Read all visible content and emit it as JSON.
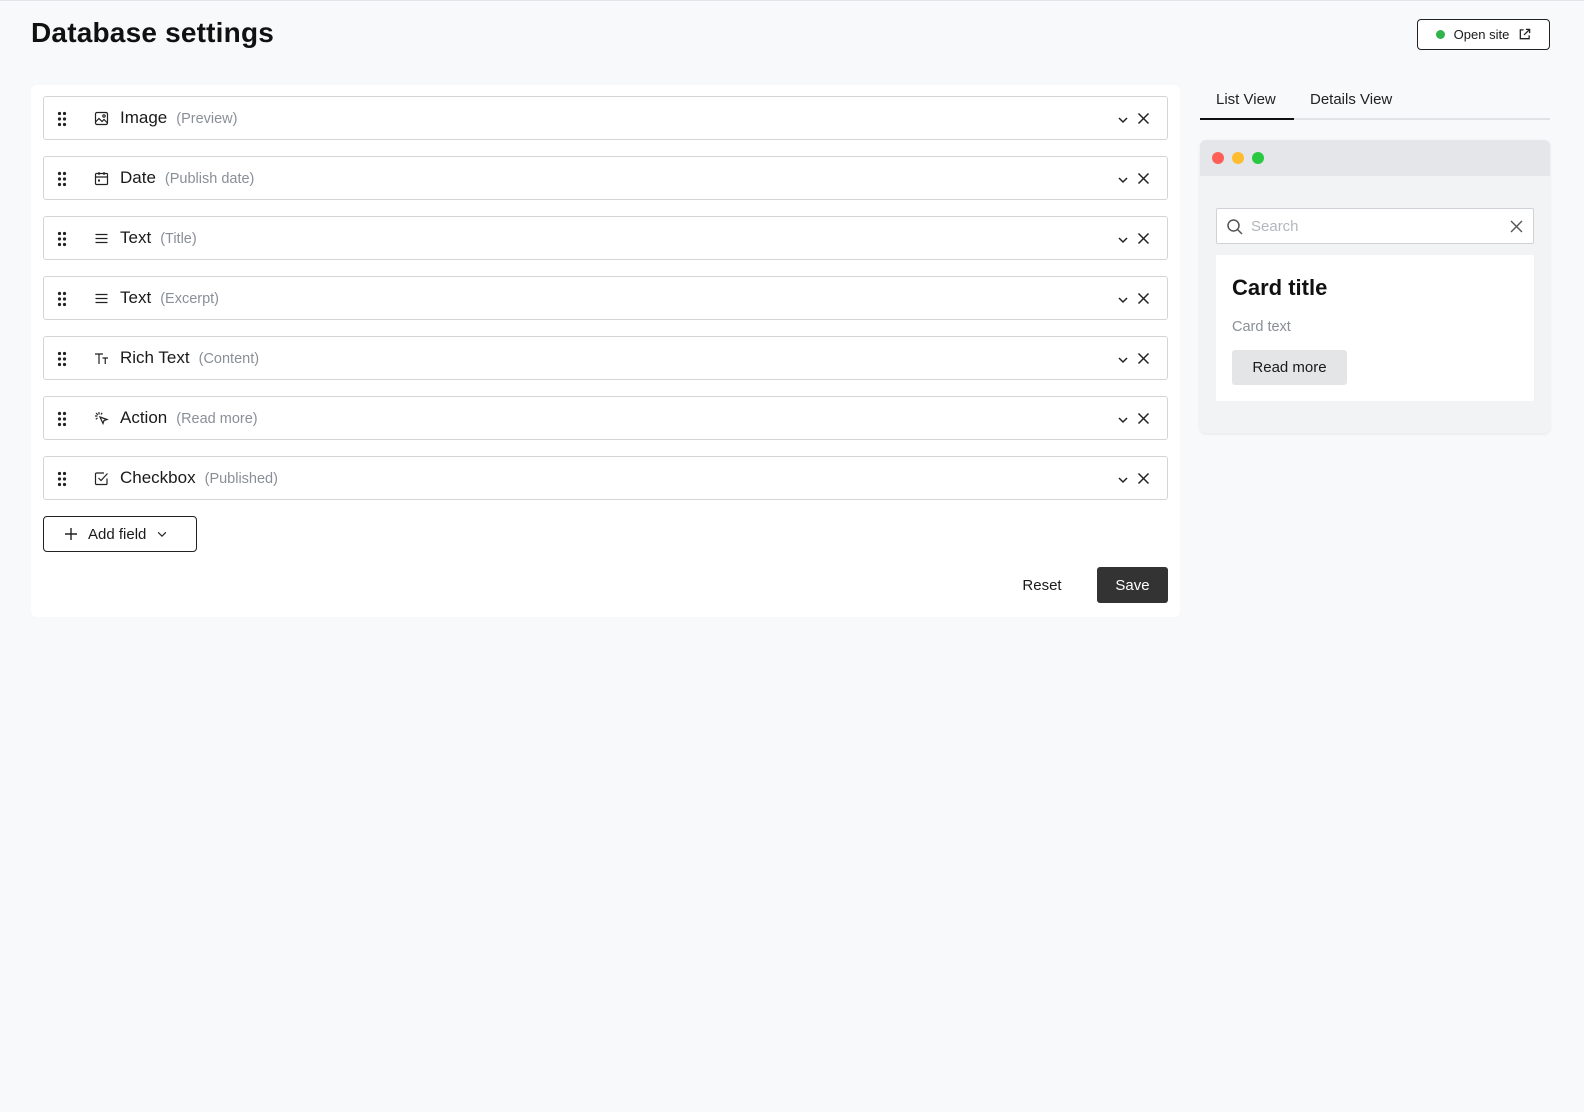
{
  "header": {
    "title": "Database settings",
    "open_site_label": "Open site",
    "status_color": "#2fb34a"
  },
  "fields": [
    {
      "type": "Image",
      "label": "(Preview)",
      "icon": "image-icon"
    },
    {
      "type": "Date",
      "label": "(Publish date)",
      "icon": "calendar-icon"
    },
    {
      "type": "Text",
      "label": "(Title)",
      "icon": "text-lines-icon"
    },
    {
      "type": "Text",
      "label": "(Excerpt)",
      "icon": "text-lines-icon"
    },
    {
      "type": "Rich Text",
      "label": "(Content)",
      "icon": "rich-text-icon"
    },
    {
      "type": "Action",
      "label": "(Read more)",
      "icon": "click-icon"
    },
    {
      "type": "Checkbox",
      "label": "(Published)",
      "icon": "checkbox-icon"
    }
  ],
  "actions": {
    "add_field_label": "Add field",
    "reset_label": "Reset",
    "save_label": "Save"
  },
  "preview": {
    "tabs": [
      "List View",
      "Details View"
    ],
    "active_tab": "List View",
    "search_placeholder": "Search",
    "card": {
      "title": "Card title",
      "text": "Card text",
      "button_label": "Read more"
    },
    "window_dots": [
      "#ff5f57",
      "#febc2e",
      "#28c840"
    ]
  }
}
